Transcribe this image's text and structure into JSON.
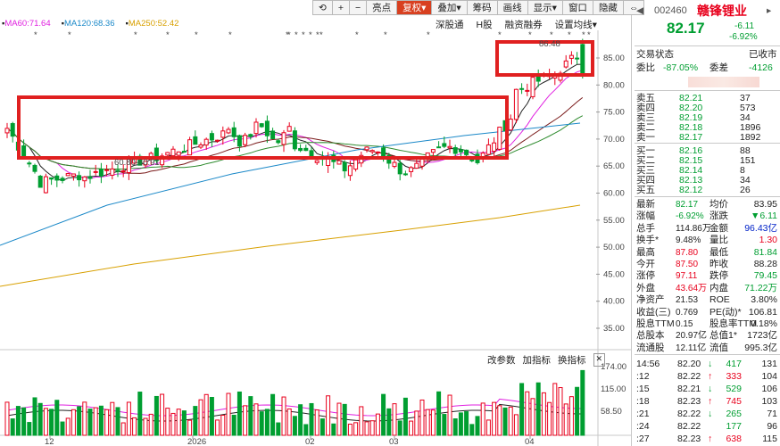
{
  "toolbar": {
    "buttons": [
      "亮点",
      "复权",
      "叠加",
      "筹码",
      "画线",
      "显示",
      "窗口",
      "隐藏"
    ],
    "icons": [
      "back-icon",
      "plus-icon",
      "minus-icon"
    ],
    "row2": [
      "深股通",
      "H股",
      "融资融券",
      "设置均线"
    ]
  },
  "ma_legend": [
    {
      "label": "MA60:71.64",
      "color": "#e020e0"
    },
    {
      "label": "MA120:68.36",
      "color": "#1a88c8"
    },
    {
      "label": "MA250:52.42",
      "color": "#d8a000"
    }
  ],
  "chart_data": {
    "type": "candlestick",
    "price_axis_ticks": [
      "85.00",
      "80.00",
      "75.00",
      "70.00",
      "65.00",
      "60.00",
      "55.00",
      "50.00",
      "45.00",
      "40.00",
      "35.00"
    ],
    "volume_axis_ticks": [
      "174.00",
      "115.00",
      "58.50"
    ],
    "x_ticks": [
      "12",
      "2026",
      "02",
      "03",
      "04"
    ],
    "annotations": [
      "60.80-60.91",
      "86.48"
    ]
  },
  "volume_toolbar": [
    "改参数",
    "加指标",
    "换指标"
  ],
  "quote": {
    "code": "002460",
    "name": "赣锋锂业",
    "price": "82.17",
    "change": "-6.11",
    "change_pct": "-6.92%",
    "status_label": "交易状态",
    "status_value": "已收市",
    "weibi_label": "委比",
    "weibi_value": "-87.05%",
    "weicha_label": "委差",
    "weicha_value": "-4126",
    "asks": [
      {
        "label": "卖五",
        "price": "82.21",
        "vol": "37"
      },
      {
        "label": "卖四",
        "price": "82.20",
        "vol": "573"
      },
      {
        "label": "卖三",
        "price": "82.19",
        "vol": "34"
      },
      {
        "label": "卖二",
        "price": "82.18",
        "vol": "1896"
      },
      {
        "label": "卖一",
        "price": "82.17",
        "vol": "1892"
      }
    ],
    "bids": [
      {
        "label": "买一",
        "price": "82.16",
        "vol": "88"
      },
      {
        "label": "买二",
        "price": "82.15",
        "vol": "151"
      },
      {
        "label": "买三",
        "price": "82.14",
        "vol": "8"
      },
      {
        "label": "买四",
        "price": "82.13",
        "vol": "34"
      },
      {
        "label": "买五",
        "price": "82.12",
        "vol": "26"
      }
    ],
    "stats": [
      [
        "最新",
        "82.17",
        "均价",
        "83.95"
      ],
      [
        "涨幅",
        "-6.92%",
        "涨跌",
        "▼6.11"
      ],
      [
        "总手",
        "114.86万",
        "金额",
        "96.43亿"
      ],
      [
        "换手*",
        "9.48%",
        "量比",
        "1.30"
      ],
      [
        "最高",
        "87.80",
        "最低",
        "81.84"
      ],
      [
        "今开",
        "87.50",
        "昨收",
        "88.28"
      ],
      [
        "涨停",
        "97.11",
        "跌停",
        "79.45"
      ],
      [
        "外盘",
        "43.64万",
        "内盘",
        "71.22万"
      ],
      [
        "净资产",
        "21.53",
        "ROE",
        "3.80%"
      ],
      [
        "收益(三)",
        "0.769",
        "PE(动)*",
        "106.81"
      ],
      [
        "股息TTM",
        "0.15",
        "股息率TTM",
        "0.18%"
      ],
      [
        "总股本",
        "20.97亿",
        "总值1*",
        "1723亿"
      ],
      [
        "流通股",
        "12.11亿",
        "流值",
        "995.3亿"
      ]
    ],
    "ticks": [
      [
        "14:56",
        "82.20",
        "↓",
        "417",
        "131"
      ],
      [
        ":12",
        "82.22",
        "↑",
        "333",
        "104"
      ],
      [
        ":15",
        "82.21",
        "↓",
        "529",
        "106"
      ],
      [
        ":18",
        "82.23",
        "↑",
        "745",
        "103"
      ],
      [
        ":21",
        "82.22",
        "↓",
        "265",
        "71"
      ],
      [
        ":24",
        "82.22",
        "",
        "177",
        "96"
      ],
      [
        ":27",
        "82.23",
        "↑",
        "638",
        "115"
      ]
    ]
  },
  "colors": {
    "up": "#e8001c",
    "down": "#009e31",
    "box": "#e02020"
  }
}
